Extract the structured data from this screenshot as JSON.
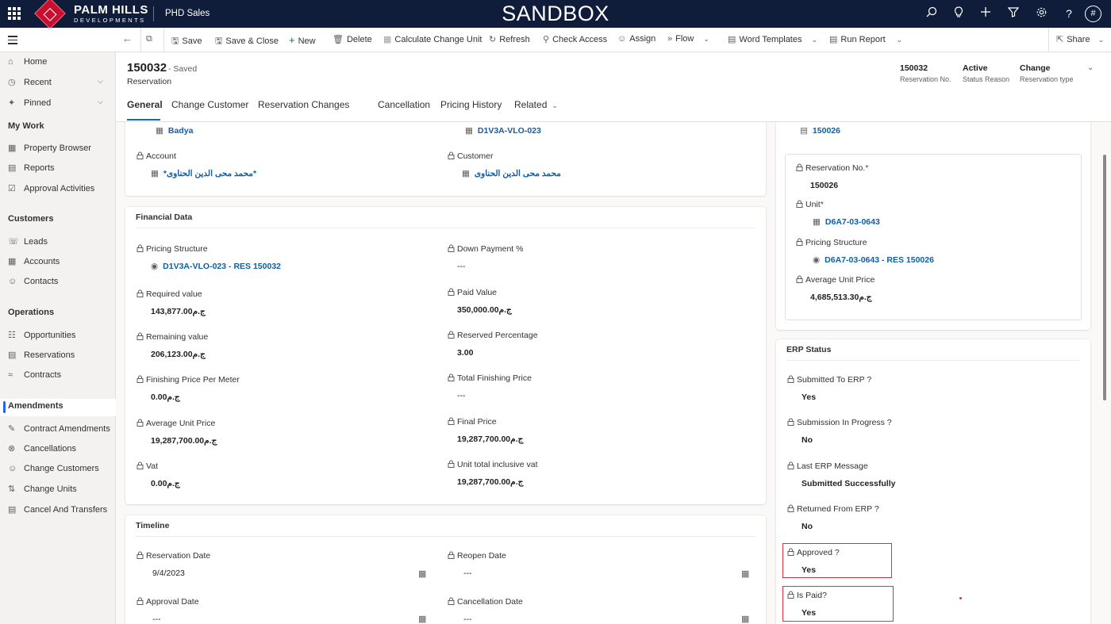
{
  "topbar": {
    "logo_main": "PALM HILLS",
    "logo_sub": "DEVELOPMENTS",
    "app_name": "PHD Sales",
    "environment": "SANDBOX",
    "avatar": "#"
  },
  "commands": {
    "save": "Save",
    "save_close": "Save & Close",
    "new": "New",
    "delete": "Delete",
    "calc_change_unit": "Calculate Change Unit",
    "refresh": "Refresh",
    "check_access": "Check Access",
    "assign": "Assign",
    "flow": "Flow",
    "word_templates": "Word Templates",
    "run_report": "Run Report",
    "share": "Share"
  },
  "sidebar": {
    "home": "Home",
    "recent": "Recent",
    "pinned": "Pinned",
    "mywork": "My Work",
    "property_browser": "Property Browser",
    "reports": "Reports",
    "approval_activities": "Approval Activities",
    "customers": "Customers",
    "leads": "Leads",
    "accounts": "Accounts",
    "contacts": "Contacts",
    "operations": "Operations",
    "opportunities": "Opportunities",
    "reservations": "Reservations",
    "contracts": "Contracts",
    "amendments": "Amendments",
    "contract_amendments": "Contract Amendments",
    "cancellations": "Cancellations",
    "change_customers": "Change Customers",
    "change_units": "Change Units",
    "cancel_transfers": "Cancel And Transfers"
  },
  "header": {
    "record_id": "150032",
    "saved": "- Saved",
    "entity": "Reservation",
    "fields": [
      {
        "value": "150032",
        "label": "Reservation No."
      },
      {
        "value": "Active",
        "label": "Status Reason"
      },
      {
        "value": "Change",
        "label": "Reservation type"
      }
    ],
    "tabs": [
      "General",
      "Change Customer",
      "Reservation Changes",
      "Cancellation",
      "Pricing History",
      "Related"
    ]
  },
  "top_card": {
    "project": "Badya",
    "unit": "D1V3A-VLO-023",
    "account_label": "Account",
    "account_value": "*محمد محى الدين الحناوى*",
    "customer_label": "Customer",
    "customer_value": "محمد محى الدين الحناوى"
  },
  "financial": {
    "title": "Financial Data",
    "pricing_structure_label": "Pricing Structure",
    "pricing_structure_value": "D1V3A-VLO-023 - RES 150032",
    "down_payment_label": "Down Payment %",
    "down_payment_value": "---",
    "required_label": "Required value",
    "required_value": "143,877.00ج.م",
    "paid_label": "Paid Value",
    "paid_value": "350,000.00ج.م",
    "remaining_label": "Remaining value",
    "remaining_value": "206,123.00ج.م",
    "reserved_pct_label": "Reserved Percentage",
    "reserved_pct_value": "3.00",
    "finishing_ppm_label": "Finishing Price Per Meter",
    "finishing_ppm_value": "0.00ج.م",
    "total_finishing_label": "Total Finishing Price",
    "total_finishing_value": "---",
    "avg_unit_label": "Average Unit Price",
    "avg_unit_value": "19,287,700.00ج.م",
    "final_price_label": "Final Price",
    "final_price_value": "19,287,700.00ج.م",
    "vat_label": "Vat",
    "vat_value": "0.00ج.م",
    "unit_total_label": "Unit total inclusive vat",
    "unit_total_value": "19,287,700.00ج.م"
  },
  "timeline": {
    "title": "Timeline",
    "reservation_date_label": "Reservation Date",
    "reservation_date_value": "9/4/2023",
    "reopen_date_label": "Reopen Date",
    "reopen_date_value": "---",
    "approval_date_label": "Approval Date",
    "approval_date_value": "---",
    "cancellation_date_label": "Cancellation Date",
    "cancellation_date_value": "---"
  },
  "related_res": {
    "top_value": "150026",
    "res_no_label": "Reservation No.",
    "res_no_value": "150026",
    "unit_label": "Unit",
    "unit_value": "D6A7-03-0643",
    "pricing_label": "Pricing Structure",
    "pricing_value": "D6A7-03-0643 - RES 150026",
    "avg_label": "Average Unit Price",
    "avg_value": "4,685,513.30ج.م"
  },
  "erp": {
    "title": "ERP Status",
    "submitted_label": "Submitted To ERP ?",
    "submitted_value": "Yes",
    "in_progress_label": "Submission In Progress ?",
    "in_progress_value": "No",
    "last_msg_label": "Last ERP Message",
    "last_msg_value": "Submitted Successfully",
    "returned_label": "Returned From ERP ?",
    "returned_value": "No",
    "approved_label": "Approved ?",
    "approved_value": "Yes",
    "paid_label": "Is Paid?",
    "paid_value": "Yes"
  },
  "colors": {
    "topbar": "#0f1c3a",
    "brand_red": "#c8102e",
    "link": "#115ea3",
    "accent": "#0f6cbd",
    "highlight": "#e0303d"
  }
}
